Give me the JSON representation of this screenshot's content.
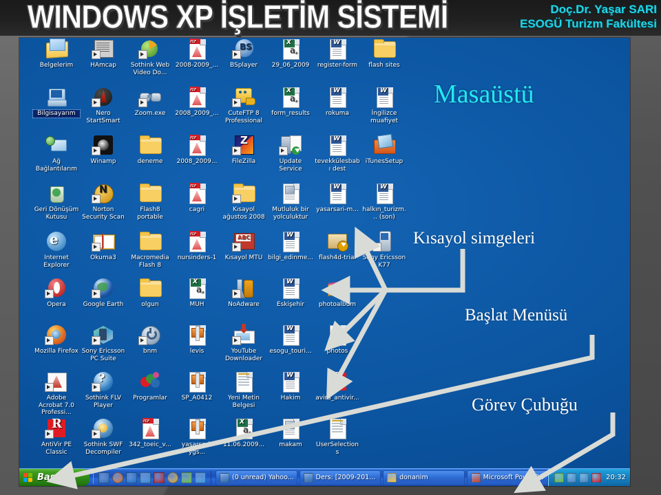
{
  "header": {
    "title": "WINDOWS XP İŞLETİM SİSTEMİ",
    "author_line1": "Doç.Dr. Yaşar SARI",
    "author_line2": "ESOGÜ Turizm Fakültesi"
  },
  "annotations": {
    "desktop": "Masaüstü",
    "shortcuts": "Kısayol simgeleri",
    "start_menu": "Başlat Menüsü",
    "taskbar": "Görev Çubuğu"
  },
  "colors": {
    "accent_cyan": "#22e8f2",
    "desktop_blue": "#0c56a2",
    "taskbar_blue": "#1b51bb",
    "start_green": "#2f8a17",
    "annotation_white": "#ffffff",
    "slide_gray": "#575757"
  },
  "desktop": {
    "columns": 7,
    "icons": [
      {
        "label": "Belgelerim",
        "type": "documents",
        "shortcut": false,
        "selected": false
      },
      {
        "label": "HAmcap",
        "type": "app-capture",
        "shortcut": true,
        "selected": false
      },
      {
        "label": "Sothink Web Video Do...",
        "type": "app-sothink",
        "shortcut": true,
        "selected": false
      },
      {
        "label": "2008-2009_...",
        "type": "pdf",
        "shortcut": false,
        "selected": false
      },
      {
        "label": "BSplayer",
        "type": "app-bsplayer",
        "shortcut": true,
        "selected": false
      },
      {
        "label": "29_06_2009",
        "type": "excel",
        "shortcut": false,
        "selected": false
      },
      {
        "label": "register-form",
        "type": "word",
        "shortcut": false,
        "selected": false
      },
      {
        "label": "flash sites",
        "type": "folder",
        "shortcut": false,
        "selected": false
      },
      {
        "label": "Bilgisayarım",
        "type": "mycomputer",
        "shortcut": false,
        "selected": true
      },
      {
        "label": "Nero StartSmart",
        "type": "app-nero",
        "shortcut": true,
        "selected": false
      },
      {
        "label": "Zoom.exe",
        "type": "app-zoom",
        "shortcut": true,
        "selected": false
      },
      {
        "label": "2008_2009_...",
        "type": "pdf",
        "shortcut": false,
        "selected": false
      },
      {
        "label": "CuteFTP 8 Professional",
        "type": "app-cuteftp",
        "shortcut": true,
        "selected": false
      },
      {
        "label": "form_results",
        "type": "excel",
        "shortcut": false,
        "selected": false
      },
      {
        "label": "rokuma",
        "type": "word",
        "shortcut": false,
        "selected": false
      },
      {
        "label": "İngilizce muafiyet",
        "type": "word",
        "shortcut": false,
        "selected": false
      },
      {
        "label": "Ağ Bağlantılarım",
        "type": "network",
        "shortcut": false,
        "selected": false
      },
      {
        "label": "Winamp",
        "type": "app-winamp",
        "shortcut": true,
        "selected": false
      },
      {
        "label": "deneme",
        "type": "folder",
        "shortcut": false,
        "selected": false
      },
      {
        "label": "2008_2009...",
        "type": "pdf",
        "shortcut": false,
        "selected": false
      },
      {
        "label": "FileZilla",
        "type": "app-filezilla",
        "shortcut": true,
        "selected": false
      },
      {
        "label": "Update Service",
        "type": "app-update",
        "shortcut": true,
        "selected": false
      },
      {
        "label": "tevekkülesbabı dest",
        "type": "word",
        "shortcut": false,
        "selected": false
      },
      {
        "label": "iTunesSetup",
        "type": "app-itunes",
        "shortcut": false,
        "selected": false
      },
      {
        "label": "Geri Dönüşüm Kutusu",
        "type": "recyclebin",
        "shortcut": false,
        "selected": false
      },
      {
        "label": "Norton Security Scan",
        "type": "app-norton",
        "shortcut": true,
        "selected": false
      },
      {
        "label": "Flash8 portable",
        "type": "folder",
        "shortcut": false,
        "selected": false
      },
      {
        "label": "cagri",
        "type": "pdf",
        "shortcut": false,
        "selected": false
      },
      {
        "label": "Kısayol ağustos 2008",
        "type": "folder",
        "shortcut": true,
        "selected": false
      },
      {
        "label": "Mutluluk bir yolculuktur",
        "type": "doc-img",
        "shortcut": false,
        "selected": false
      },
      {
        "label": "yasarsari-m...",
        "type": "word",
        "shortcut": false,
        "selected": false
      },
      {
        "label": "halkın_turizm... (son)",
        "type": "word",
        "shortcut": false,
        "selected": false
      },
      {
        "label": "Internet Explorer",
        "type": "app-ie",
        "shortcut": false,
        "selected": false
      },
      {
        "label": "Okuma3",
        "type": "app-book",
        "shortcut": true,
        "selected": false
      },
      {
        "label": "Macromedia Flash 8",
        "type": "folder",
        "shortcut": false,
        "selected": false
      },
      {
        "label": "nursinders-1",
        "type": "pdf",
        "shortcut": false,
        "selected": false
      },
      {
        "label": "Kısayol MTU",
        "type": "app-abc",
        "shortcut": true,
        "selected": false
      },
      {
        "label": "bilgi_edinme...",
        "type": "word",
        "shortcut": false,
        "selected": false
      },
      {
        "label": "flash4d-trial",
        "type": "app-install",
        "shortcut": false,
        "selected": false
      },
      {
        "label": "Sony Ericsson K77",
        "type": "app-phone",
        "shortcut": true,
        "selected": false
      },
      {
        "label": "Opera",
        "type": "app-opera",
        "shortcut": true,
        "selected": false
      },
      {
        "label": "Google Earth",
        "type": "app-earth",
        "shortcut": true,
        "selected": false
      },
      {
        "label": "olgun",
        "type": "folder",
        "shortcut": false,
        "selected": false
      },
      {
        "label": "MUH",
        "type": "excel",
        "shortcut": false,
        "selected": false
      },
      {
        "label": "NoAdware",
        "type": "app-tools",
        "shortcut": true,
        "selected": false
      },
      {
        "label": "Eskişehir",
        "type": "word",
        "shortcut": false,
        "selected": false
      },
      {
        "label": "photoalbum",
        "type": "archive",
        "shortcut": false,
        "selected": false
      },
      {
        "label": "Mozilla Firefox",
        "type": "app-firefox",
        "shortcut": true,
        "selected": false
      },
      {
        "label": "Sony Ericsson PC Suite",
        "type": "app-sepcsuite",
        "shortcut": true,
        "selected": false
      },
      {
        "label": "bnm",
        "type": "app-power",
        "shortcut": true,
        "selected": false
      },
      {
        "label": "levis",
        "type": "archive-red",
        "shortcut": false,
        "selected": false
      },
      {
        "label": "YouTube Downloader",
        "type": "app-youtube",
        "shortcut": true,
        "selected": false
      },
      {
        "label": "esogu_touri...",
        "type": "word",
        "shortcut": false,
        "selected": false
      },
      {
        "label": "photos",
        "type": "htmlfile",
        "shortcut": false,
        "selected": false
      },
      {
        "label": "Adobe Acrobat 7.0 Professi...",
        "type": "app-acrobat",
        "shortcut": true,
        "selected": false
      },
      {
        "label": "Sothink FLV Player",
        "type": "app-flv",
        "shortcut": true,
        "selected": false
      },
      {
        "label": "Programlar",
        "type": "app-colors",
        "shortcut": false,
        "selected": false
      },
      {
        "label": "SP_A0412",
        "type": "archive-red",
        "shortcut": false,
        "selected": false
      },
      {
        "label": "Yeni Metin Belgesi",
        "type": "notepad",
        "shortcut": false,
        "selected": false
      },
      {
        "label": "Hakim",
        "type": "word",
        "shortcut": false,
        "selected": false
      },
      {
        "label": "avira_antivir...",
        "type": "app-avira",
        "shortcut": false,
        "selected": false
      },
      {
        "label": "AntiVir PE Classic",
        "type": "app-avira",
        "shortcut": true,
        "selected": false
      },
      {
        "label": "Sothink SWF Decompiler",
        "type": "app-swf",
        "shortcut": true,
        "selected": false
      },
      {
        "label": "342_toeic_v...",
        "type": "pdf",
        "shortcut": false,
        "selected": false
      },
      {
        "label": "yasarsari-ygs...",
        "type": "archive-red",
        "shortcut": false,
        "selected": false
      },
      {
        "label": "11.06.2009...",
        "type": "excel",
        "shortcut": false,
        "selected": false
      },
      {
        "label": "makam",
        "type": "doc-img",
        "shortcut": false,
        "selected": false
      },
      {
        "label": "UserSelections",
        "type": "notepad",
        "shortcut": false,
        "selected": false
      }
    ]
  },
  "taskbar": {
    "start_label": "Başlat",
    "quick_launch": [
      {
        "name": "show-desktop-icon",
        "color": "#2f6fb5"
      },
      {
        "name": "firefox-quick-icon",
        "color": "#e2711d"
      },
      {
        "name": "media-player-quick-icon",
        "color": "#1a6fc4"
      },
      {
        "name": "internet-explorer-quick-icon",
        "color": "#3b8fd4"
      },
      {
        "name": "dictionary-quick-icon",
        "color": "#c01c1c"
      },
      {
        "name": "avg-quick-icon",
        "color": "#e8a81c"
      },
      {
        "name": "msn-quick-icon",
        "color": "#6fbf3b"
      },
      {
        "name": "picture-quick-icon",
        "color": "#3d9ad9"
      }
    ],
    "tasks": [
      {
        "label": "(0 unread) Yahoo...",
        "icon": "browser-window-icon",
        "color": "#2f6fb5"
      },
      {
        "label": "Ders: [2009-201...",
        "icon": "browser-window-icon",
        "color": "#2f6fb5"
      },
      {
        "label": "donanim",
        "icon": "folder-icon",
        "color": "#f5c542"
      },
      {
        "label": "Microsoft PowerP...",
        "icon": "powerpoint-icon",
        "color": "#d24726"
      }
    ],
    "tray": [
      {
        "name": "safely-remove-icon",
        "color": "#6fbf3b"
      },
      {
        "name": "network-icon",
        "color": "#4a84c8"
      },
      {
        "name": "network2-icon",
        "color": "#4a84c8"
      },
      {
        "name": "avira-tray-icon",
        "color": "#e01b24"
      }
    ],
    "clock": "20:32"
  }
}
